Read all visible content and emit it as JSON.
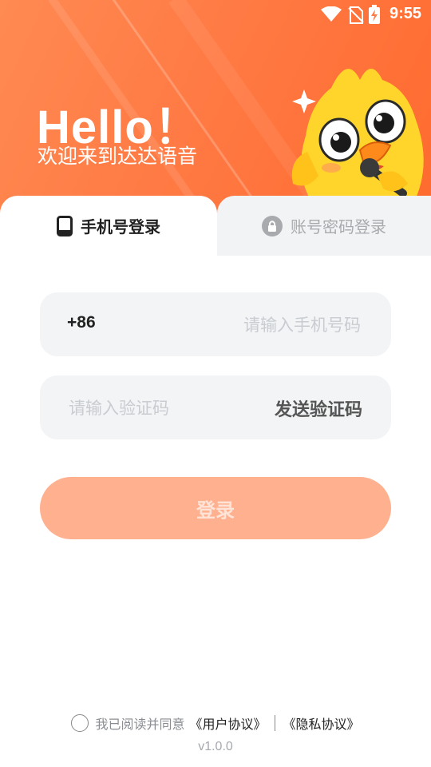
{
  "status_bar": {
    "time": "9:55",
    "icons": [
      "wifi-icon",
      "no-sim-icon",
      "battery-charging-icon"
    ]
  },
  "header": {
    "greeting": "Hello！",
    "welcome": "欢迎来到达达语音"
  },
  "tabs": [
    {
      "label": "手机号登录",
      "icon": "phone-icon",
      "active": true
    },
    {
      "label": "账号密码登录",
      "icon": "lock-icon",
      "active": false
    }
  ],
  "phone": {
    "prefix": "+86",
    "placeholder": "请输入手机号码",
    "value": ""
  },
  "code": {
    "placeholder": "请输入验证码",
    "value": "",
    "send_label": "发送验证码"
  },
  "login": {
    "label": "登录"
  },
  "footer": {
    "agree_text": "我已阅读并同意",
    "user_agreement": "《用户协议》",
    "privacy_agreement": "《隐私协议》",
    "version": "v1.0.0"
  },
  "colors": {
    "brand": "#ff7a44",
    "button_disabled": "#ffb08f",
    "field_bg": "#f2f4f6"
  }
}
